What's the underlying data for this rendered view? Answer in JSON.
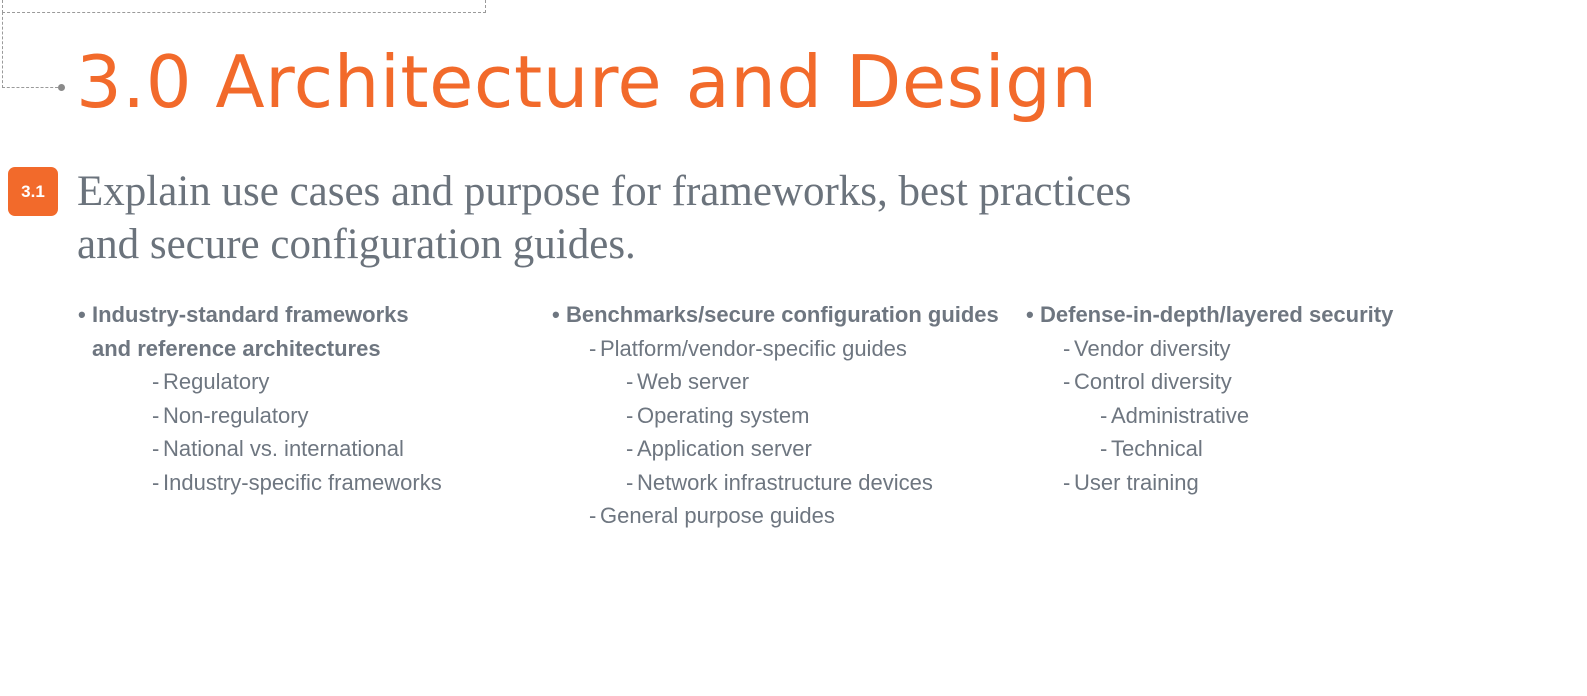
{
  "title": "3.0 Architecture and Design",
  "objective": {
    "badge": "3.1",
    "text": "Explain use cases and purpose for frameworks, best practices and secure configuration guides."
  },
  "columns": [
    {
      "items": [
        {
          "level": 0,
          "bold": true,
          "text": "Industry-standard frameworks"
        },
        {
          "level": 0,
          "bold": true,
          "cont": true,
          "text": "and reference architectures"
        },
        {
          "level": 2,
          "text": "Regulatory"
        },
        {
          "level": 2,
          "text": "Non-regulatory"
        },
        {
          "level": 2,
          "text": "National vs. international"
        },
        {
          "level": 2,
          "text": "Industry-specific frameworks"
        }
      ]
    },
    {
      "items": [
        {
          "level": 0,
          "bold": true,
          "text": "Benchmarks/secure configuration guides"
        },
        {
          "level": 1,
          "text": "Platform/vendor-specific guides"
        },
        {
          "level": 2,
          "text": "Web server"
        },
        {
          "level": 2,
          "text": "Operating system"
        },
        {
          "level": 2,
          "text": "Application server"
        },
        {
          "level": 2,
          "text": "Network infrastructure devices"
        },
        {
          "level": 1,
          "text": "General purpose guides"
        }
      ]
    },
    {
      "items": [
        {
          "level": 0,
          "bold": true,
          "text": "Defense-in-depth/layered security"
        },
        {
          "level": 1,
          "text": "Vendor diversity"
        },
        {
          "level": 1,
          "text": "Control diversity"
        },
        {
          "level": 2,
          "text": "Administrative"
        },
        {
          "level": 2,
          "text": "Technical"
        },
        {
          "level": 1,
          "text": "User training"
        }
      ]
    }
  ]
}
